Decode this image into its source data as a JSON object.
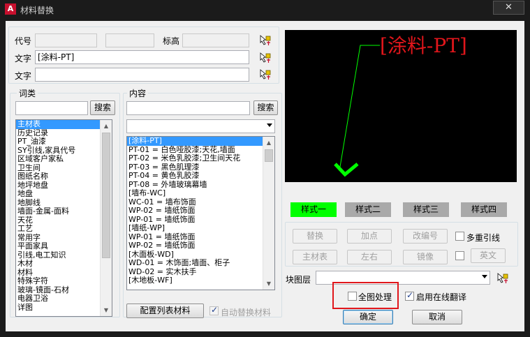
{
  "window": {
    "title": "材料替换",
    "close_glyph": "✕"
  },
  "top": {
    "code_label": "代号",
    "elevation_label": "标高",
    "text1_label": "文字",
    "text1_value": "[涂料-PT]",
    "text2_label": "文字",
    "text2_value": ""
  },
  "vocab": {
    "title": "词类",
    "search_button": "搜索",
    "items": [
      "主材表",
      "历史记录",
      "PT_油漆",
      "SY引线,家具代号",
      "区域客户家私",
      "卫生间",
      "图纸名称",
      "地坪地盘",
      "地盘",
      "地脚线",
      "墙面-金属-面料",
      "天花",
      "工艺",
      "常用字",
      "平面家具",
      "引线,电工知识",
      "木材",
      "材料",
      "特殊字符",
      "玻璃-镜面-石材",
      "电器卫浴",
      "详图"
    ],
    "selected_index": 0
  },
  "content": {
    "title": "内容",
    "search_button": "搜索",
    "combo_value": "",
    "items": [
      "[涂料-PT]",
      "PT-01 = 白色哑胶漆;天花,墙面",
      "PT-02 = 米色乳胶漆;卫生间天花",
      "PT-03 = 黑色肌理漆",
      "PT-04 = 黄色乳胶漆",
      "PT-08 = 外墙玻璃幕墙",
      "[墙布-WC]",
      "WC-01 = 墙布饰面",
      "WP-02 = 墙纸饰面",
      "WP-01 = 墙纸饰面",
      "[墙纸-WP]",
      "WP-01 = 墙纸饰面",
      "WP-02 = 墙纸饰面",
      "[木面板-WD]",
      "WD-01 = 木饰面;墙面、柜子",
      "WD-02 = 实木扶手",
      "[木地板-WF]"
    ],
    "selected_index": 0,
    "config_button": "配置列表材料",
    "auto_replace_label": "自动替换材料",
    "auto_replace_checked": true
  },
  "preview": {
    "text": "[涂料-PT]",
    "text_color": "#e0161b",
    "leader_color": "#00ff00"
  },
  "styles": {
    "buttons": [
      "样式一",
      "样式二",
      "样式三",
      "样式四"
    ],
    "active_index": 0,
    "active_color": "#00ff00"
  },
  "actions": {
    "replace": "替换",
    "add_point": "加点",
    "renumber": "改编号",
    "multi_leader": "多重引线",
    "main_table": "主材表",
    "left_right": "左右",
    "mirror": "镜像",
    "english": "英文"
  },
  "layer": {
    "label": "块图层",
    "value": ""
  },
  "options": {
    "whole_drawing_label": "全图处理",
    "whole_drawing_checked": false,
    "online_translate_label": "启用在线翻译",
    "online_translate_checked": true
  },
  "dialog": {
    "ok": "确定",
    "cancel": "取消"
  }
}
